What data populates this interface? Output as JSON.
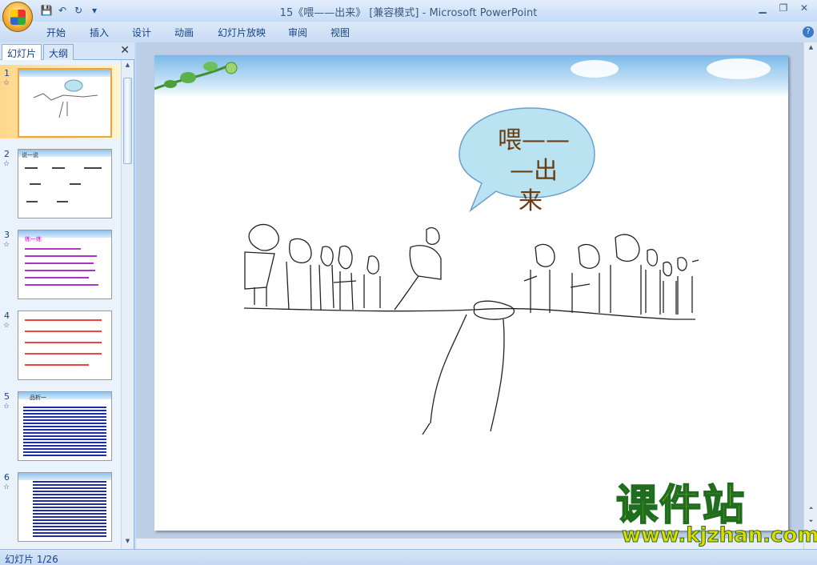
{
  "window": {
    "title": "15《喂——出来》 [兼容模式] - Microsoft PowerPoint",
    "minimize": "▁",
    "restore": "❐",
    "close": "✕"
  },
  "qat": {
    "save_icon": "💾",
    "undo_icon": "↶",
    "redo_icon": "↻",
    "more_icon": "▾"
  },
  "ribbon": {
    "tabs": [
      "开始",
      "插入",
      "设计",
      "动画",
      "幻灯片放映",
      "审阅",
      "视图"
    ],
    "help": "?"
  },
  "panel": {
    "tab_slides": "幻灯片",
    "tab_outline": "大纲",
    "close": "✕",
    "slides": [
      {
        "num": "1",
        "star": "☆"
      },
      {
        "num": "2",
        "star": "☆"
      },
      {
        "num": "3",
        "star": "☆"
      },
      {
        "num": "4",
        "star": "☆"
      },
      {
        "num": "5",
        "star": "☆"
      },
      {
        "num": "6",
        "star": "☆"
      }
    ],
    "thumb2_title": "说一说",
    "thumb3_title": "练一练",
    "thumb5_title": "品析一"
  },
  "slide": {
    "bubble_line1": "喂——",
    "bubble_line2": "—出",
    "bubble_line3": "来"
  },
  "watermark": {
    "cn": "课件站",
    "url": "www.kjzhan.com"
  },
  "status": {
    "text": "幻灯片 1/26"
  },
  "colors": {
    "accent": "#15428b",
    "bubble_fill": "#b9e3f1",
    "bubble_text": "#7a4a1a"
  }
}
